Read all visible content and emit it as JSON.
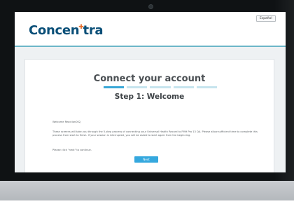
{
  "header": {
    "logo_text_a": "Concen",
    "logo_text_b": "tra",
    "language_button": "Español"
  },
  "main": {
    "title": "Connect your account",
    "step_title": "Step 1: Welcome",
    "progress": {
      "current_step": 1,
      "total_steps": 5
    },
    "welcome": "Welcome Reaction002,",
    "intro": "These screens will take you through the 5-step process of connecting your Universal Health Record to FMH Pro 13 QA. Please allow sufficient time to complete this process from start to finish. If your session is interrupted, you will be asked to start again from the beginning.",
    "instruction": "Please click \"next\" to continue.",
    "next_label": "Next"
  },
  "colors": {
    "brand_blue": "#0a4f78",
    "brand_orange": "#e86e2a",
    "accent": "#35a8de",
    "progress_inactive": "#c6e4ee"
  }
}
